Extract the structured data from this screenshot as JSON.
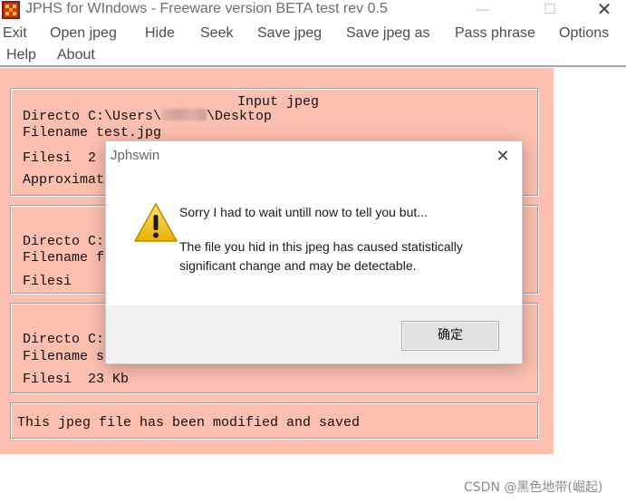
{
  "window": {
    "title": "JPHS for WIndows - Freeware version BETA test rev 0.5",
    "icon": "jphs-app-icon",
    "minimize_glyph": "—",
    "maximize_glyph": "☐",
    "close_glyph": "✕"
  },
  "menu": {
    "items": [
      "Exit",
      "Open jpeg",
      "Hide",
      "Seek",
      "Save jpeg",
      "Save jpeg as",
      "Pass phrase",
      "Options",
      "Help",
      "About"
    ]
  },
  "input_group": {
    "heading": "Input jpeg",
    "directory_label": "Directo",
    "directory_value_prefix": "C:\\Users\\",
    "directory_value_suffix": "\\Desktop",
    "filename_label": "Filename",
    "filename_value": "test.jpg",
    "filesize_label": "Filesi",
    "filesize_value": "2",
    "approx_label": "Approximate"
  },
  "hidden_group": {
    "directory_label": "Directo",
    "directory_value": "C:",
    "filename_label": "Filename",
    "filename_value": "fl",
    "filesize_label": "Filesi"
  },
  "output_group": {
    "directory_label": "Directo",
    "directory_value": "C:",
    "filename_label": "Filename",
    "filename_value": "st",
    "filesize_label": "Filesi",
    "filesize_value": "23 Kb"
  },
  "status": {
    "text": "This jpeg file has been modified and saved"
  },
  "dialog": {
    "title": "Jphswin",
    "icon": "warning-icon",
    "close_glyph": "✕",
    "message_line1": "Sorry I had to wait untill now to tell you but...",
    "message_line2": "The file you hid in this jpeg has caused statistically significant change and may be detectable.",
    "ok_label": "确定"
  },
  "watermark": "CSDN @黑色地带(崛起)",
  "colors": {
    "client_bg": "#fdbfb0",
    "warning_yellow": "#f5c518"
  }
}
